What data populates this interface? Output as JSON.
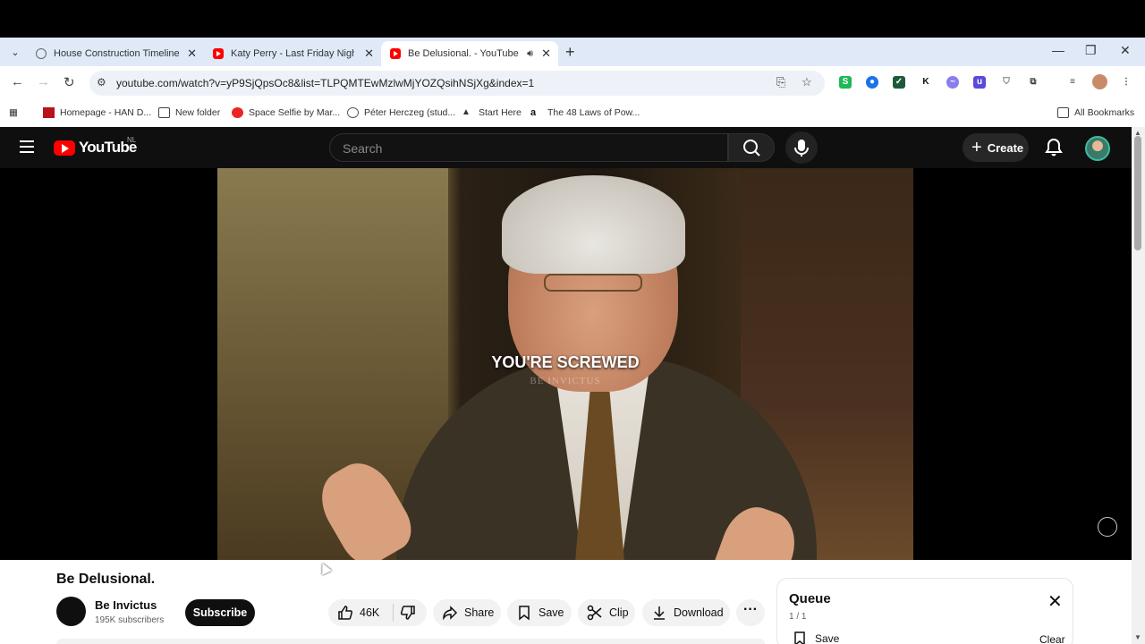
{
  "browser": {
    "tabs": [
      {
        "title": "House Construction Timeline",
        "icon": "globe-icon",
        "active": false
      },
      {
        "title": "Katy Perry - Last Friday Night (T",
        "icon": "youtube-icon",
        "active": false
      },
      {
        "title": "Be Delusional. - YouTube",
        "icon": "youtube-icon",
        "active": true
      }
    ],
    "url": "youtube.com/watch?v=yP9SjQpsOc8&list=TLPQMTEwMzlwMjYOZQsihNSjXg&index=1",
    "bookmarks": [
      {
        "label": "Homepage - HAN D...",
        "icon": "han-icon"
      },
      {
        "label": "New folder",
        "icon": "folder-icon"
      },
      {
        "label": "Space Selfie by Mar...",
        "icon": "space-selfie-icon"
      },
      {
        "label": "Péter Herczeg (stud...",
        "icon": "globe-icon"
      },
      {
        "label": "Start Here",
        "icon": "triangle-icon"
      },
      {
        "label": "The 48 Laws of Pow...",
        "icon": "amazon-icon"
      }
    ],
    "all_bookmarks": "All Bookmarks"
  },
  "youtube": {
    "logo_text": "YouTube",
    "region": "NL",
    "search_placeholder": "Search",
    "create_label": "Create",
    "video": {
      "caption": "YOU'RE SCREWED",
      "watermark": "BE INVICTUS"
    },
    "title": "Be Delusional.",
    "channel": {
      "name": "Be Invictus",
      "subscribers": "195K subscribers"
    },
    "subscribe_label": "Subscribe",
    "actions": {
      "likes": "46K",
      "share": "Share",
      "save": "Save",
      "clip": "Clip",
      "download": "Download"
    },
    "queue": {
      "title": "Queue",
      "count": "1 / 1",
      "save": "Save",
      "clear": "Clear"
    }
  },
  "colors": {
    "brand_red": "#ff0000",
    "dark_bg": "#0f0f0f",
    "chrome_tabstrip": "#dfe9f8"
  }
}
